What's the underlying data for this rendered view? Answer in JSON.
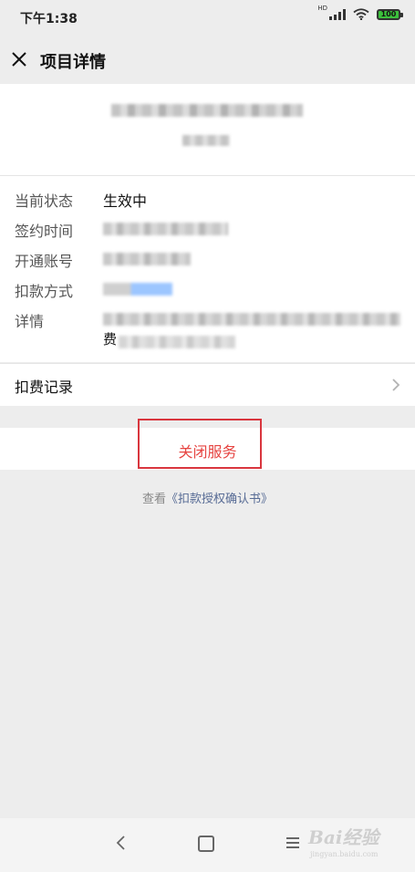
{
  "status_bar": {
    "time": "下午1:38",
    "network": "HD",
    "battery": "100"
  },
  "nav": {
    "title": "项目详情",
    "close_icon": "close-icon"
  },
  "details": [
    {
      "label": "当前状态",
      "value": "生效中"
    },
    {
      "label": "签约时间",
      "value": ""
    },
    {
      "label": "开通账号",
      "value": ""
    },
    {
      "label": "扣款方式",
      "value": ""
    },
    {
      "label": "详情",
      "value": "费"
    }
  ],
  "fee_record": {
    "label": "扣费记录"
  },
  "close_service": {
    "label": "关闭服务",
    "color": "#e64340"
  },
  "agreement": {
    "prefix": "查看",
    "link": "《扣款授权确认书》"
  },
  "watermark": {
    "text": "Bai经验",
    "sub": "jingyan.baidu.com"
  },
  "colors": {
    "background": "#ededed",
    "danger": "#e64340",
    "link": "#576b95",
    "highlight_box": "#d9363e"
  }
}
